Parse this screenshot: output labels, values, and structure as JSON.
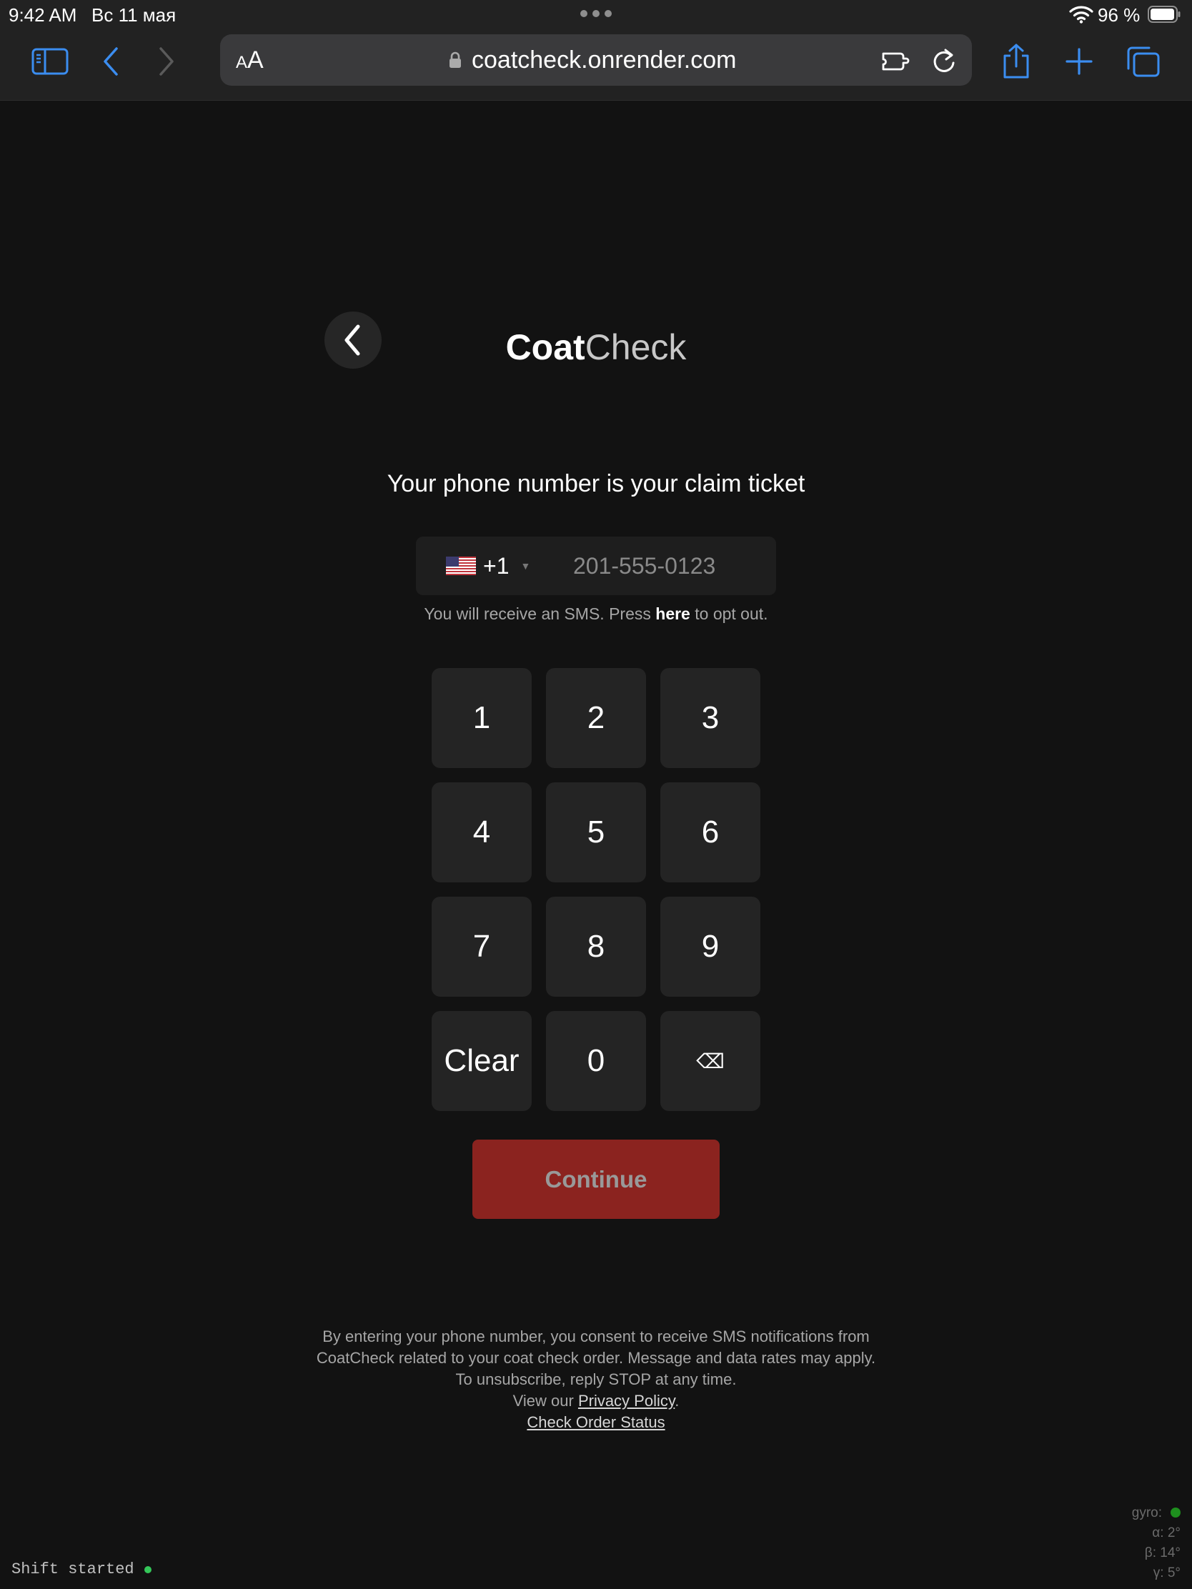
{
  "status_bar": {
    "time": "9:42 AM",
    "date": "Вс 11 мая",
    "battery": "96 %"
  },
  "browser": {
    "text_size_label_small": "A",
    "text_size_label_large": "A",
    "url": "coatcheck.onrender.com",
    "icons": [
      "sidebar-icon",
      "back-arrow-icon",
      "forward-arrow-icon",
      "lock-icon",
      "extensions-icon",
      "reload-icon",
      "share-icon",
      "new-tab-plus-icon",
      "tabs-overview-icon"
    ],
    "accent_color": "#3b8df0"
  },
  "page": {
    "logo_bold": "Coat",
    "logo_light": "Check",
    "headline": "Your phone number is your claim ticket",
    "country_code": "+1",
    "country_flag": "us-flag-icon",
    "phone_placeholder": "201-555-0123",
    "phone_value": "",
    "sms_note_before": "You will receive an SMS. Press ",
    "sms_note_link": "here",
    "sms_note_after": " to opt out.",
    "keypad": [
      "1",
      "2",
      "3",
      "4",
      "5",
      "6",
      "7",
      "8",
      "9",
      "Clear",
      "0",
      "⌫"
    ],
    "continue_label": "Continue",
    "continue_color": "#8b231f",
    "consent_text": "By entering your phone number, you consent to receive SMS notifications from CoatCheck related to your coat check order. Message and data rates may apply. To unsubscribe, reply STOP at any time.",
    "view_our": "View our ",
    "privacy_link": "Privacy Policy",
    "period": ".",
    "order_status_link": "Check Order Status"
  },
  "debug": {
    "shift_status": "Shift started",
    "gyro_label": "gyro:",
    "alpha": "α: 2°",
    "beta": "β: 14°",
    "gamma": "γ: 5°"
  }
}
